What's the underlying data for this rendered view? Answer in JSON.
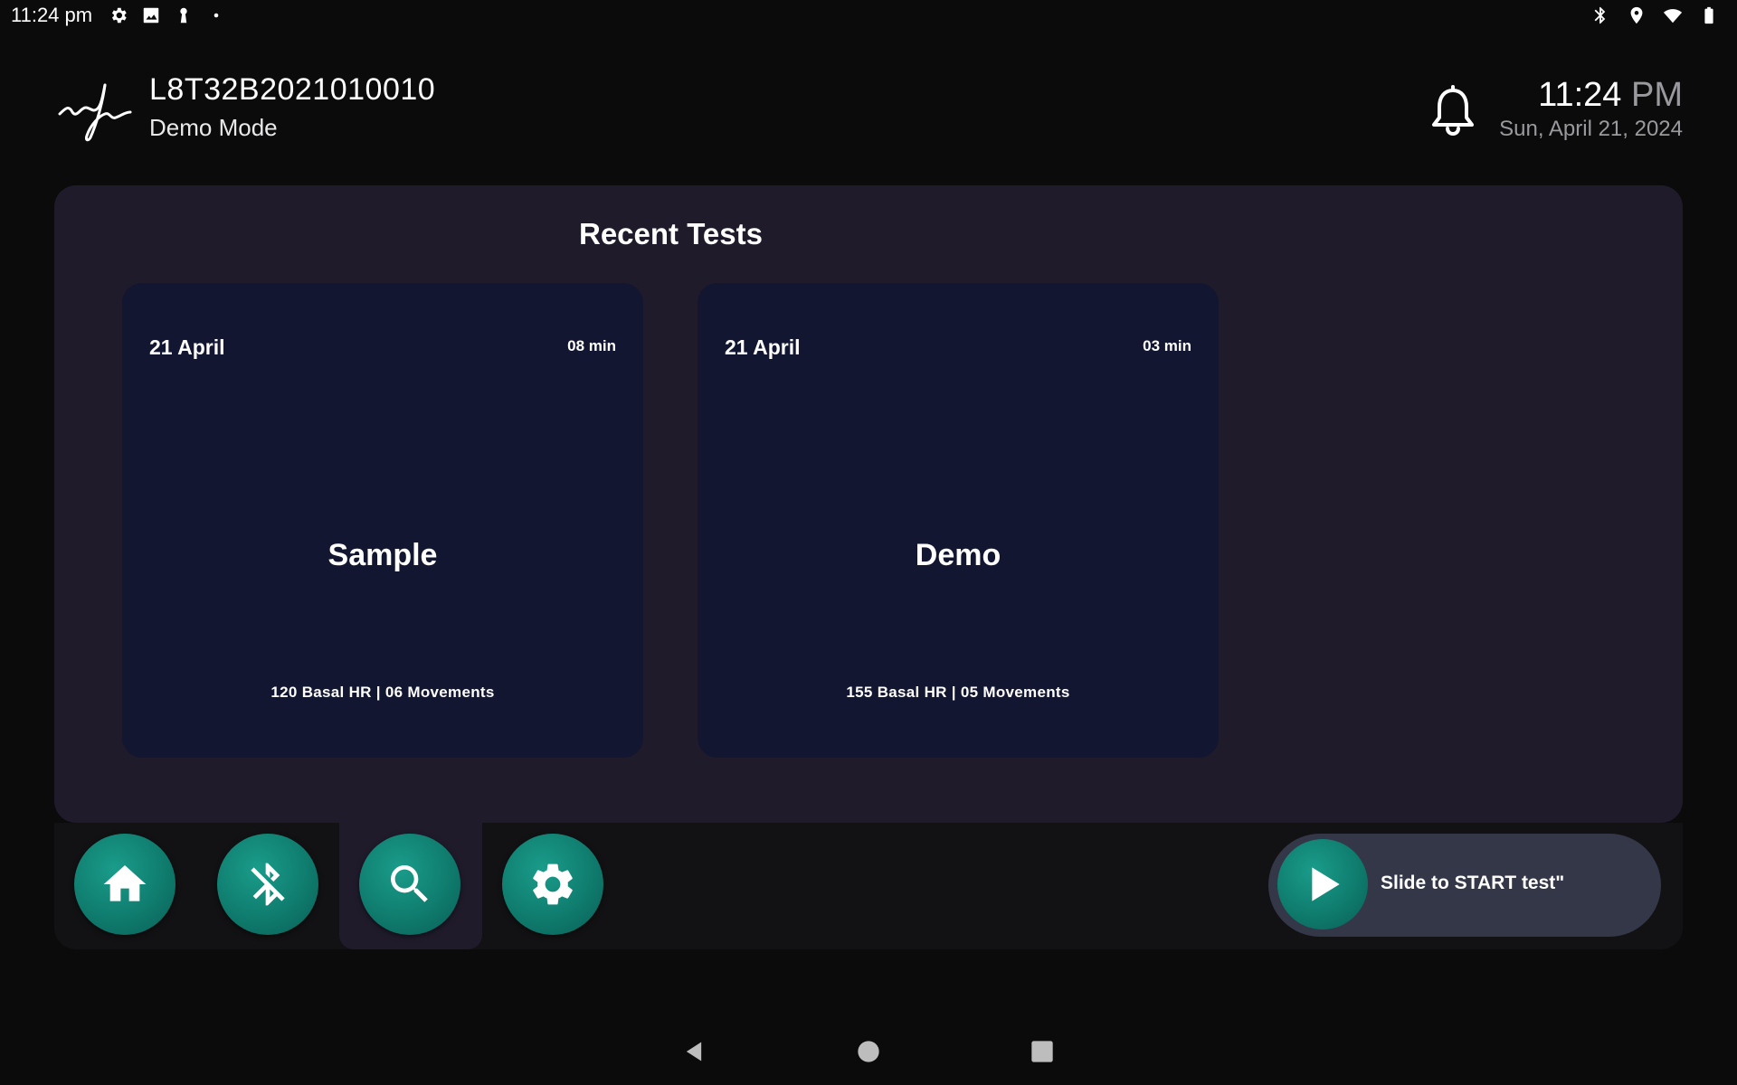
{
  "status_bar": {
    "time": "11:24 pm",
    "left_icons": [
      "gear-icon",
      "image-icon",
      "keyhole-icon",
      "dot-icon"
    ],
    "right_icons": [
      "bluetooth-icon",
      "location-icon",
      "wifi-icon",
      "battery-icon"
    ]
  },
  "header": {
    "device_id": "L8T32B2021010010",
    "mode": "Demo Mode",
    "clock_time": "11:24",
    "clock_ampm": "PM",
    "clock_date": "Sun, April 21, 2024"
  },
  "recent_tests": {
    "title": "Recent Tests",
    "cards": [
      {
        "date": "21 April",
        "duration": "08 min",
        "name": "Sample",
        "stats": "120 Basal HR | 06 Movements"
      },
      {
        "date": "21 April",
        "duration": "03 min",
        "name": "Demo",
        "stats": "155 Basal HR | 05 Movements"
      }
    ]
  },
  "nav": {
    "buttons": [
      "home-icon",
      "bluetooth-off-icon",
      "search-icon",
      "settings-icon"
    ],
    "active": "search-icon"
  },
  "slider": {
    "label": "Slide to START test\""
  },
  "colors": {
    "accent": "#0f7c6e",
    "panel": "#1f1b2b",
    "card": "#121630",
    "background": "#0b0b0c"
  }
}
